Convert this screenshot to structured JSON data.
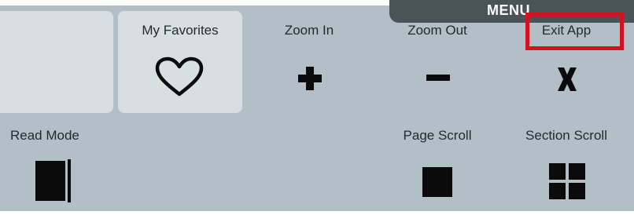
{
  "menu": {
    "title": "MENU"
  },
  "items": {
    "favorites": {
      "label": "My Favorites",
      "icon": "heart-icon"
    },
    "zoom_in": {
      "label": "Zoom In",
      "icon": "plus-icon"
    },
    "zoom_out": {
      "label": "Zoom Out",
      "icon": "minus-icon"
    },
    "exit_app": {
      "label": "Exit App",
      "icon": "x-icon"
    },
    "read_mode": {
      "label": "Read Mode",
      "icon": "book-icon"
    },
    "page_scroll": {
      "label": "Page Scroll",
      "icon": "square-icon"
    },
    "section_scroll": {
      "label": "Section Scroll",
      "icon": "grid-icon"
    }
  },
  "colors": {
    "panel": "#b2bfc6",
    "tile": "#d7dfe3",
    "menu_tab": "#4a5358",
    "highlight": "#d4121e"
  }
}
